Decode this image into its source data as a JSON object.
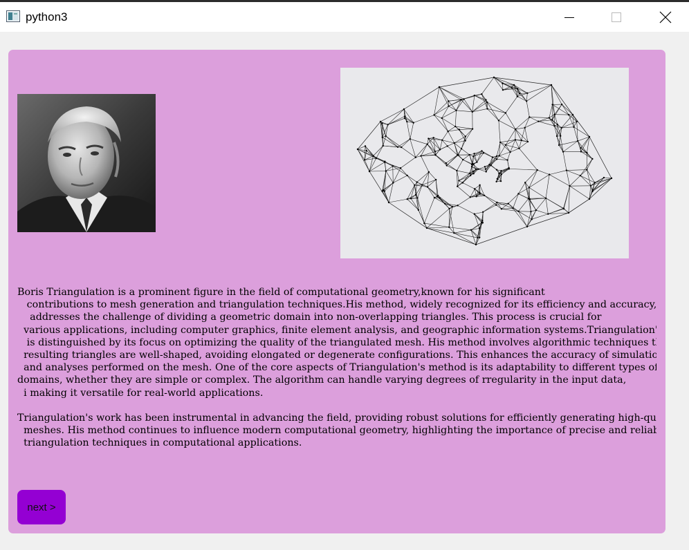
{
  "window": {
    "title": "python3"
  },
  "content": {
    "paragraph1_lines": [
      "Boris Triangulation is a prominent figure in the field of computational geometry,known for his significant",
      "   contributions to mesh generation and triangulation techniques.His method, widely recognized for its efficiency and accuracy,",
      "    addresses the challenge of dividing a geometric domain into non-overlapping triangles. This process is crucial for",
      "  various applications, including computer graphics, finite element analysis, and geographic information systems.Triangulation's appr",
      "   is distinguished by its focus on optimizing the quality of the triangulated mesh. His method involves algorithmic techniques that en",
      "  resulting triangles are well-shaped, avoiding elongated or degenerate configurations. This enhances the accuracy of simulations",
      "  and analyses performed on the mesh. One of the core aspects of Triangulation's method is its adaptability to different types of",
      "domains, whether they are simple or complex. The algorithm can handle varying degrees of rregularity in the input data,",
      "  i making it versatile for real-world applications."
    ],
    "paragraph2_lines": [
      "Triangulation's work has been instrumental in advancing the field, providing robust solutions for efficiently generating high-quality",
      "  meshes. His method continues to influence modern computational geometry, highlighting the importance of precise and reliable",
      "  triangulation techniques in computational applications."
    ]
  },
  "buttons": {
    "next_label": "next >"
  },
  "colors": {
    "panel_background": "#dc9fdc",
    "next_button": "#9400d3",
    "window_background": "#f0f0f0"
  },
  "icons": {
    "app": "python-window-icon",
    "minimize": "minimize-icon",
    "maximize": "maximize-icon",
    "close": "close-icon"
  }
}
